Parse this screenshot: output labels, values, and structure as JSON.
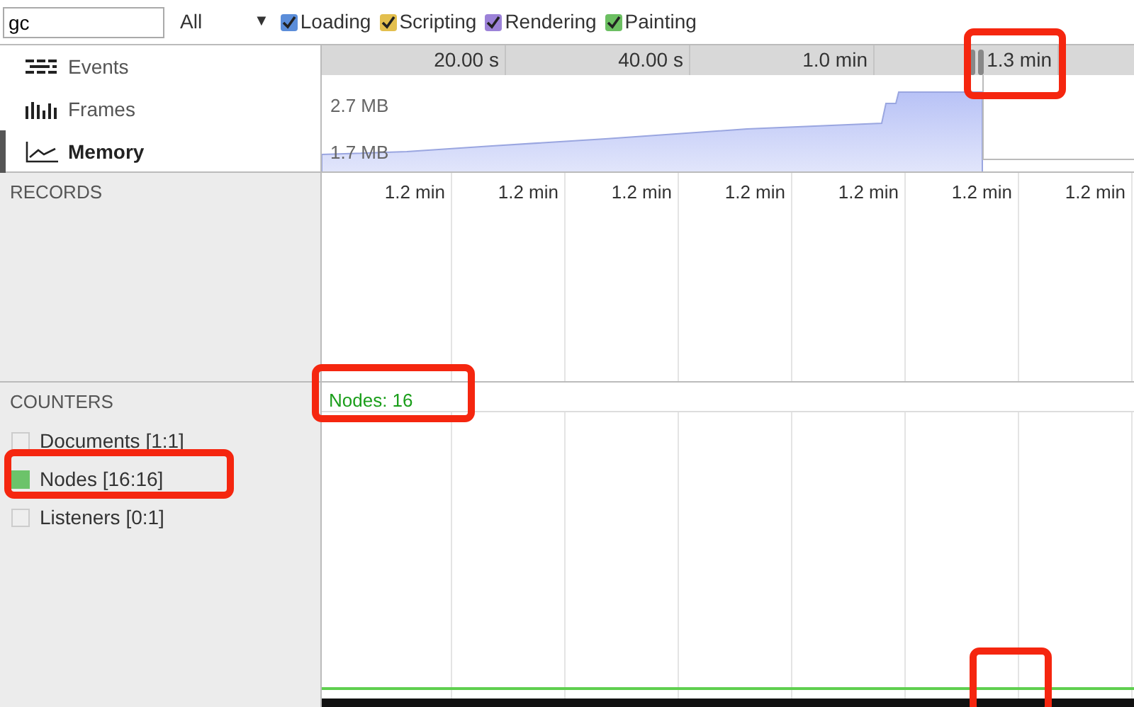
{
  "toolbar": {
    "search": {
      "value": "gc"
    },
    "filter": {
      "value": "All",
      "arrow": "▼"
    },
    "categories": [
      {
        "label": "Loading",
        "checked": true,
        "color": "#5b8dd9"
      },
      {
        "label": "Scripting",
        "checked": true,
        "color": "#e3bf4e"
      },
      {
        "label": "Rendering",
        "checked": true,
        "color": "#9c82d8"
      },
      {
        "label": "Painting",
        "checked": true,
        "color": "#6cbf62"
      }
    ]
  },
  "overview": {
    "modes": [
      {
        "kind": "events",
        "label": "Events",
        "selected": false
      },
      {
        "kind": "frames",
        "label": "Frames",
        "selected": false
      },
      {
        "kind": "memory",
        "label": "Memory",
        "selected": true
      }
    ],
    "ruler": [
      "20.00 s",
      "40.00 s",
      "1.0 min",
      "1.3 min"
    ],
    "memory_labels": [
      "2.7 MB",
      "1.7 MB"
    ]
  },
  "records": {
    "title": "RECORDS",
    "ruler": [
      "1.2 min",
      "1.2 min",
      "1.2 min",
      "1.2 min",
      "1.2 min",
      "1.2 min",
      "1.2 min"
    ]
  },
  "counters": {
    "title": "COUNTERS",
    "items": [
      {
        "label": "Documents [1:1]",
        "checked": false
      },
      {
        "label": "Nodes [16:16]",
        "checked": true,
        "color": "#6cc36a"
      },
      {
        "label": "Listeners [0:1]",
        "checked": false
      }
    ],
    "graph_label": "Nodes: 16"
  }
}
